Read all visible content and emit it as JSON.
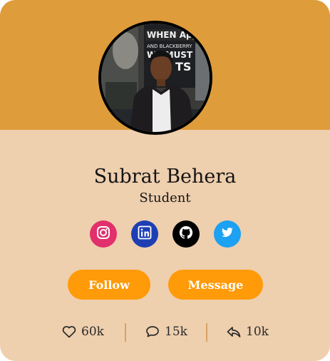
{
  "profile": {
    "name": "Subrat Behera",
    "role": "Student",
    "poster_text_1": "WHEN Apple",
    "poster_text_2": "AND BLACKBERRY",
    "poster_text_3": "WE MUST",
    "poster_text_4": "TS"
  },
  "socials": [
    {
      "icon": "instagram-icon",
      "color": "#e1306c"
    },
    {
      "icon": "linkedin-icon",
      "color": "#1d3fb3"
    },
    {
      "icon": "github-icon",
      "color": "#000000"
    },
    {
      "icon": "twitter-icon",
      "color": "#1da1f2"
    }
  ],
  "actions": {
    "follow_label": "Follow",
    "message_label": "Message"
  },
  "stats": {
    "likes": "60k",
    "comments": "15k",
    "shares": "10k"
  },
  "colors": {
    "banner": "#df9c3b",
    "card": "#eecfae",
    "button": "#ff9a08",
    "divider": "#d7a366"
  }
}
